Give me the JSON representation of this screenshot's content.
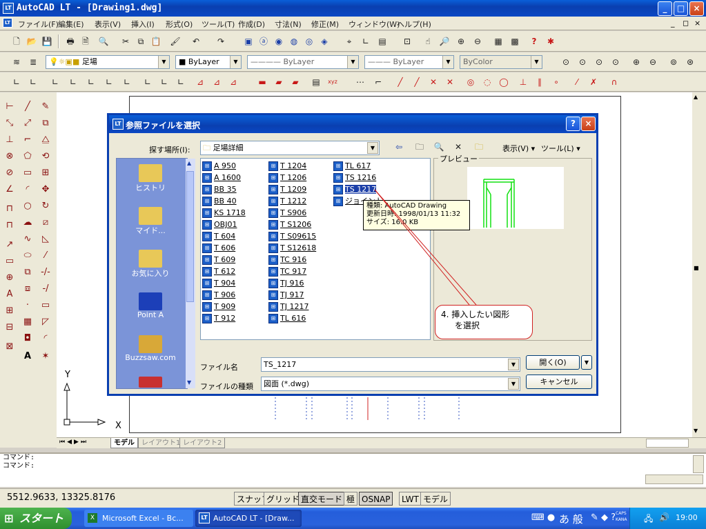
{
  "app": {
    "title": "AutoCAD LT - [Drawing1.dwg]",
    "icon_label": "LT",
    "window_buttons": [
      "_",
      "□",
      "×"
    ]
  },
  "menu": {
    "items": [
      "ファイル(F)",
      "編集(E)",
      "表示(V)",
      "挿入(I)",
      "形式(O)",
      "ツール(T)",
      "作成(D)",
      "寸法(N)",
      "修正(M)",
      "ウィンドウ(W)",
      "ヘルプ(H)"
    ]
  },
  "properties_toolbar": {
    "layer": "足場",
    "color": "ByLayer",
    "linetype": "ByLayer",
    "lineweight": "ByLayer",
    "plotstyle": "ByColor"
  },
  "drawing": {
    "axis_x": "X",
    "axis_y": "Y",
    "tabs": [
      "モデル",
      "レイアウト1",
      "レイアウト2"
    ]
  },
  "command": {
    "lines": [
      "コマンド:",
      "コマンド:"
    ]
  },
  "status": {
    "coords": "5512.9633,  13325.8176",
    "buttons": [
      "スナップ",
      "グリッド",
      "直交モード",
      "極",
      "OSNAP",
      "LWT",
      "モデル"
    ]
  },
  "taskbar": {
    "start": "スタート",
    "items": [
      "Microsoft Excel - Bc...",
      "AutoCAD LT - [Draw..."
    ],
    "clock": "19:00",
    "tray_ime": "あ 般",
    "caps": "CAPS",
    "kana": "KANA"
  },
  "dialog": {
    "title": "参照ファイルを選択",
    "icon_label": "LT",
    "help_btn": "?",
    "close_btn": "×",
    "lookin_label": "探す場所(I):",
    "lookin_value": "足場詳細",
    "view_menu": "表示(V)",
    "tools_menu": "ツール(L)",
    "preview_label": "プレビュー",
    "places": [
      "ヒストリ",
      "マイド...",
      "お気に入り",
      "Point A",
      "Buzzsaw.com"
    ],
    "files_col1": [
      "A 950",
      "A 1600",
      "BB 35",
      "BB 40",
      "KS 1718",
      "OBJ01",
      "T 604",
      "T 606",
      "T 609",
      "T 612",
      "T 904",
      "T 906",
      "T 909",
      "T 912"
    ],
    "files_col2": [
      "T 1204",
      "T 1206",
      "T 1209",
      "T 1212",
      "T S906",
      "T S1206",
      "T S09615",
      "T S12618",
      "TC 916",
      "TC 917",
      "TJ 916",
      "TJ 917",
      "TJ 1217",
      "TL 616"
    ],
    "files_col3": [
      "TL 617",
      "TS 1216",
      "TS 1217",
      "ジョイント"
    ],
    "selected_file": "TS 1217",
    "tooltip": {
      "type": "種類: AutoCAD Drawing",
      "updated": "更新日時: 1998/01/13 11:32",
      "size": "サイズ: 16.0 KB"
    },
    "filename_label": "ファイル名",
    "filename_value": "TS_1217",
    "filetype_label": "ファイルの種類",
    "filetype_value": "図面 (*.dwg)",
    "open_btn": "開く(O)",
    "cancel_btn": "キャンセル"
  },
  "callout": {
    "line1": "4. 挿入したい図形",
    "line2": "を選択"
  }
}
